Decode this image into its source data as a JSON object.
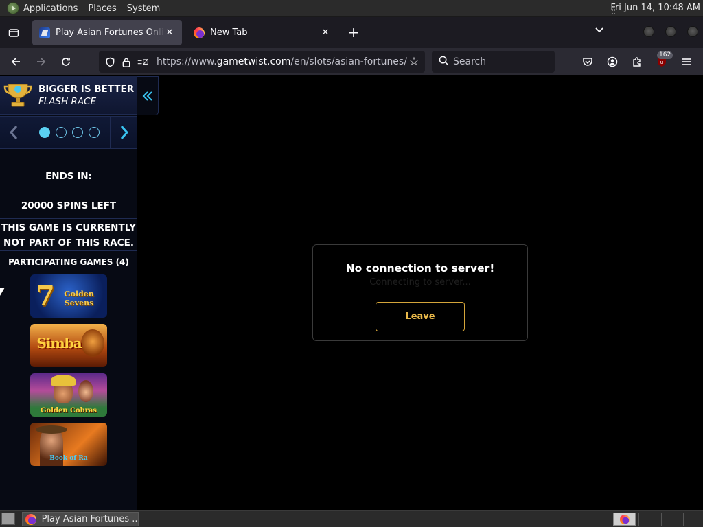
{
  "top_panel": {
    "menus": [
      "Applications",
      "Places",
      "System"
    ],
    "clock": "Fri Jun 14, 10:48 AM"
  },
  "tabs": [
    {
      "title": "Play Asian Fortunes Online f",
      "active": true,
      "favicon": "gametwist-icon"
    },
    {
      "title": "New Tab",
      "active": false,
      "favicon": "firefox-icon"
    }
  ],
  "navbar": {
    "url_prefix": "https://www.",
    "url_host": "gametwist.com",
    "url_path": "/en/slots/asian-fortunes/",
    "search_placeholder": "Search",
    "badge_count": "162"
  },
  "race": {
    "title": "BIGGER IS BETTER",
    "subtitle": "FLASH RACE",
    "ends_in_label": "ENDS IN:",
    "spins_left": "20000 SPINS LEFT",
    "not_part_line1": "THIS GAME IS CURRENTLY",
    "not_part_line2": "NOT PART OF THIS RACE.",
    "participating_label": "PARTICIPATING GAMES (4)",
    "games": [
      "Golden Sevens",
      "Simba",
      "Golden Cobras",
      "Book of Ra"
    ],
    "carousel_active": 0,
    "carousel_count": 4
  },
  "modal": {
    "title": "No connection to server!",
    "subtitle": "Connecting to server...",
    "leave_label": "Leave"
  },
  "taskbar": {
    "task_label": "Play Asian Fortunes ..."
  },
  "colors": {
    "accent_cyan": "#39c3f0",
    "leave_gold": "#d4a53a",
    "race_navy": "#1a2447"
  }
}
